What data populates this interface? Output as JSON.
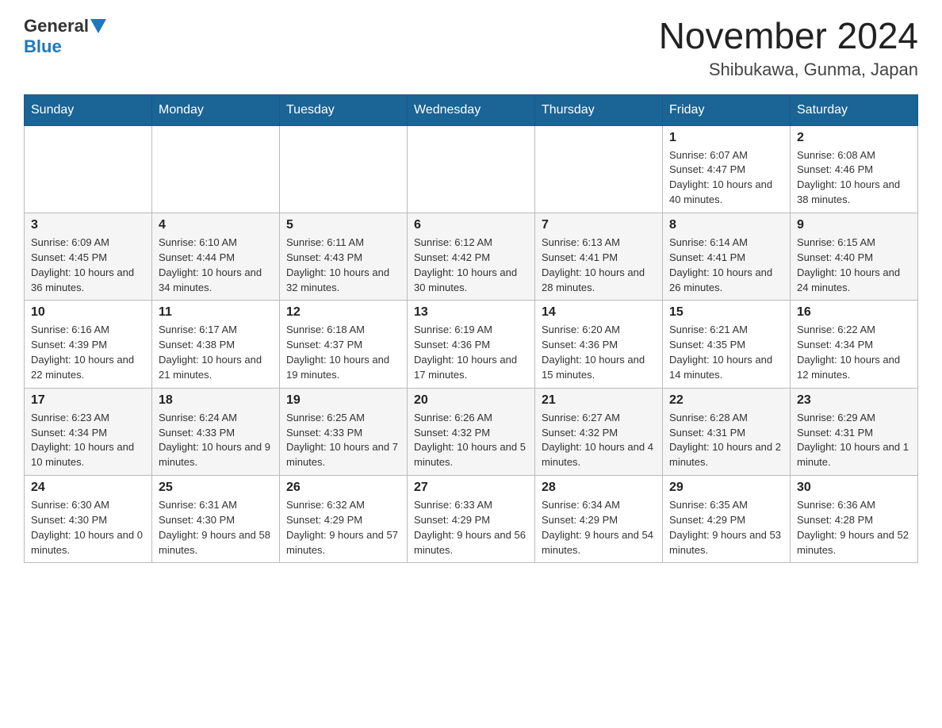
{
  "header": {
    "logo_general": "General",
    "logo_blue": "Blue",
    "month_title": "November 2024",
    "location": "Shibukawa, Gunma, Japan"
  },
  "weekdays": [
    "Sunday",
    "Monday",
    "Tuesday",
    "Wednesday",
    "Thursday",
    "Friday",
    "Saturday"
  ],
  "weeks": [
    {
      "days": [
        {
          "number": "",
          "info": ""
        },
        {
          "number": "",
          "info": ""
        },
        {
          "number": "",
          "info": ""
        },
        {
          "number": "",
          "info": ""
        },
        {
          "number": "",
          "info": ""
        },
        {
          "number": "1",
          "info": "Sunrise: 6:07 AM\nSunset: 4:47 PM\nDaylight: 10 hours and 40 minutes."
        },
        {
          "number": "2",
          "info": "Sunrise: 6:08 AM\nSunset: 4:46 PM\nDaylight: 10 hours and 38 minutes."
        }
      ]
    },
    {
      "days": [
        {
          "number": "3",
          "info": "Sunrise: 6:09 AM\nSunset: 4:45 PM\nDaylight: 10 hours and 36 minutes."
        },
        {
          "number": "4",
          "info": "Sunrise: 6:10 AM\nSunset: 4:44 PM\nDaylight: 10 hours and 34 minutes."
        },
        {
          "number": "5",
          "info": "Sunrise: 6:11 AM\nSunset: 4:43 PM\nDaylight: 10 hours and 32 minutes."
        },
        {
          "number": "6",
          "info": "Sunrise: 6:12 AM\nSunset: 4:42 PM\nDaylight: 10 hours and 30 minutes."
        },
        {
          "number": "7",
          "info": "Sunrise: 6:13 AM\nSunset: 4:41 PM\nDaylight: 10 hours and 28 minutes."
        },
        {
          "number": "8",
          "info": "Sunrise: 6:14 AM\nSunset: 4:41 PM\nDaylight: 10 hours and 26 minutes."
        },
        {
          "number": "9",
          "info": "Sunrise: 6:15 AM\nSunset: 4:40 PM\nDaylight: 10 hours and 24 minutes."
        }
      ]
    },
    {
      "days": [
        {
          "number": "10",
          "info": "Sunrise: 6:16 AM\nSunset: 4:39 PM\nDaylight: 10 hours and 22 minutes."
        },
        {
          "number": "11",
          "info": "Sunrise: 6:17 AM\nSunset: 4:38 PM\nDaylight: 10 hours and 21 minutes."
        },
        {
          "number": "12",
          "info": "Sunrise: 6:18 AM\nSunset: 4:37 PM\nDaylight: 10 hours and 19 minutes."
        },
        {
          "number": "13",
          "info": "Sunrise: 6:19 AM\nSunset: 4:36 PM\nDaylight: 10 hours and 17 minutes."
        },
        {
          "number": "14",
          "info": "Sunrise: 6:20 AM\nSunset: 4:36 PM\nDaylight: 10 hours and 15 minutes."
        },
        {
          "number": "15",
          "info": "Sunrise: 6:21 AM\nSunset: 4:35 PM\nDaylight: 10 hours and 14 minutes."
        },
        {
          "number": "16",
          "info": "Sunrise: 6:22 AM\nSunset: 4:34 PM\nDaylight: 10 hours and 12 minutes."
        }
      ]
    },
    {
      "days": [
        {
          "number": "17",
          "info": "Sunrise: 6:23 AM\nSunset: 4:34 PM\nDaylight: 10 hours and 10 minutes."
        },
        {
          "number": "18",
          "info": "Sunrise: 6:24 AM\nSunset: 4:33 PM\nDaylight: 10 hours and 9 minutes."
        },
        {
          "number": "19",
          "info": "Sunrise: 6:25 AM\nSunset: 4:33 PM\nDaylight: 10 hours and 7 minutes."
        },
        {
          "number": "20",
          "info": "Sunrise: 6:26 AM\nSunset: 4:32 PM\nDaylight: 10 hours and 5 minutes."
        },
        {
          "number": "21",
          "info": "Sunrise: 6:27 AM\nSunset: 4:32 PM\nDaylight: 10 hours and 4 minutes."
        },
        {
          "number": "22",
          "info": "Sunrise: 6:28 AM\nSunset: 4:31 PM\nDaylight: 10 hours and 2 minutes."
        },
        {
          "number": "23",
          "info": "Sunrise: 6:29 AM\nSunset: 4:31 PM\nDaylight: 10 hours and 1 minute."
        }
      ]
    },
    {
      "days": [
        {
          "number": "24",
          "info": "Sunrise: 6:30 AM\nSunset: 4:30 PM\nDaylight: 10 hours and 0 minutes."
        },
        {
          "number": "25",
          "info": "Sunrise: 6:31 AM\nSunset: 4:30 PM\nDaylight: 9 hours and 58 minutes."
        },
        {
          "number": "26",
          "info": "Sunrise: 6:32 AM\nSunset: 4:29 PM\nDaylight: 9 hours and 57 minutes."
        },
        {
          "number": "27",
          "info": "Sunrise: 6:33 AM\nSunset: 4:29 PM\nDaylight: 9 hours and 56 minutes."
        },
        {
          "number": "28",
          "info": "Sunrise: 6:34 AM\nSunset: 4:29 PM\nDaylight: 9 hours and 54 minutes."
        },
        {
          "number": "29",
          "info": "Sunrise: 6:35 AM\nSunset: 4:29 PM\nDaylight: 9 hours and 53 minutes."
        },
        {
          "number": "30",
          "info": "Sunrise: 6:36 AM\nSunset: 4:28 PM\nDaylight: 9 hours and 52 minutes."
        }
      ]
    }
  ]
}
